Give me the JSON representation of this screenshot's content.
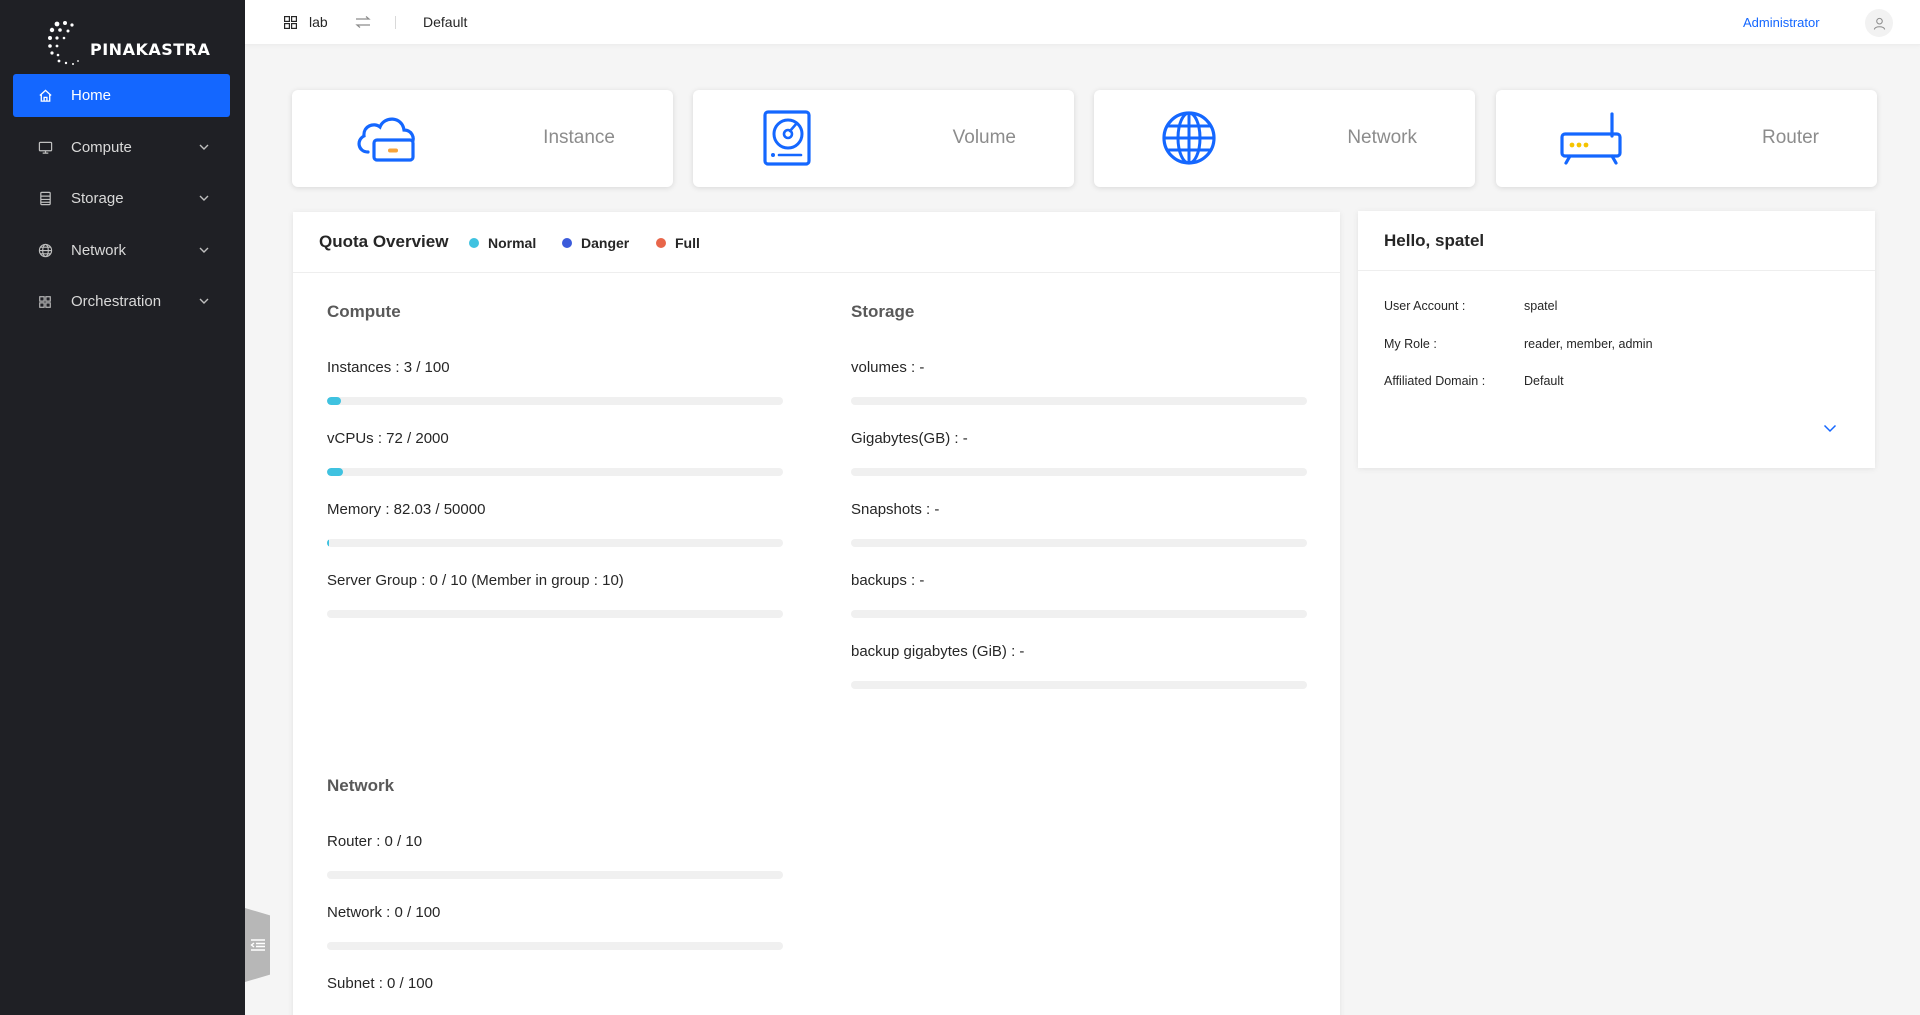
{
  "brand": {
    "name": "PINAKASTRA"
  },
  "sidebar": {
    "items": [
      {
        "label": "Home",
        "icon": "home-icon",
        "active": true
      },
      {
        "label": "Compute",
        "icon": "monitor-icon"
      },
      {
        "label": "Storage",
        "icon": "database-icon"
      },
      {
        "label": "Network",
        "icon": "globe-icon"
      },
      {
        "label": "Orchestration",
        "icon": "grid-icon"
      }
    ]
  },
  "header": {
    "project": "lab",
    "domain": "Default",
    "role_link": "Administrator"
  },
  "resources": [
    {
      "label": "Instance",
      "icon": "cloud-server-icon"
    },
    {
      "label": "Volume",
      "icon": "disk-icon"
    },
    {
      "label": "Network",
      "icon": "globe-icon"
    },
    {
      "label": "Router",
      "icon": "router-icon"
    }
  ],
  "quota": {
    "title": "Quota Overview",
    "legend": [
      {
        "label": "Normal",
        "color": "#3fc2e0"
      },
      {
        "label": "Danger",
        "color": "#3b5bdb"
      },
      {
        "label": "Full",
        "color": "#e8664a"
      }
    ],
    "compute": {
      "title": "Compute",
      "rows": [
        {
          "label": "Instances : 3 / 100",
          "fraction": 0.03
        },
        {
          "label": "vCPUs : 72 / 2000",
          "fraction": 0.036
        },
        {
          "label": "Memory : 82.03 / 50000",
          "fraction": 0.0016
        },
        {
          "label": "Server Group : 0 / 10 (Member in group : 10)",
          "fraction": 0
        }
      ]
    },
    "storage": {
      "title": "Storage",
      "rows": [
        {
          "label": "volumes : -",
          "fraction": 0
        },
        {
          "label": "Gigabytes(GB) : -",
          "fraction": 0
        },
        {
          "label": "Snapshots : -",
          "fraction": 0
        },
        {
          "label": "backups : -",
          "fraction": 0
        },
        {
          "label": "backup gigabytes (GiB) : -",
          "fraction": 0
        }
      ]
    },
    "network": {
      "title": "Network",
      "rows": [
        {
          "label": "Router : 0 / 10",
          "fraction": 0
        },
        {
          "label": "Network : 0 / 100",
          "fraction": 0
        },
        {
          "label": "Subnet : 0 / 100",
          "fraction": 0
        }
      ]
    }
  },
  "hello": {
    "title": "Hello, spatel",
    "info": [
      {
        "label": "User Account :",
        "value": "spatel"
      },
      {
        "label": "My Role :",
        "value": "reader, member, admin"
      },
      {
        "label": "Affiliated Domain :",
        "value": "Default"
      }
    ]
  }
}
